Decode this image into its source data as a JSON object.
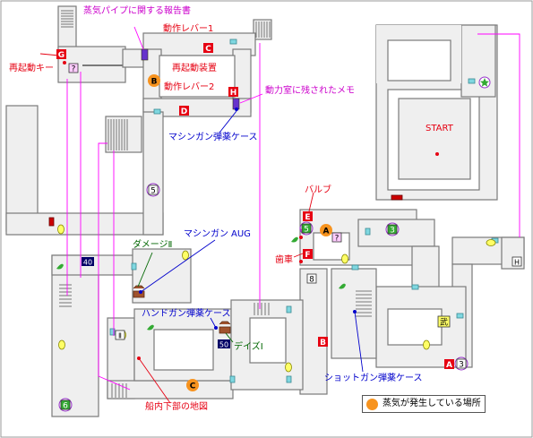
{
  "labels": {
    "steam_pipe_report": "蒸気パイプに関する報告書",
    "operate_lever_1": "動作レバー1",
    "restart_device": "再起動装置",
    "operate_lever_2": "動作レバー2",
    "power_room_memo": "動力室に残されたメモ",
    "restart_key": "再起動キー",
    "machinegun_ammo_case_1": "マシンガン弾薬ケース",
    "valve": "バルブ",
    "gear": "歯車",
    "damage_2": "ダメージⅡ",
    "machinegun": "マシンガン",
    "aug": "AUG",
    "handgun_ammo_case": "ハンドガン弾薬ケース",
    "days_1": "デイズⅠ",
    "shotgun_ammo_case": "ショットガン弾薬ケース",
    "lower_ship_map": "船内下部の地図",
    "start": "START"
  },
  "markers": {
    "G": "G",
    "C": "C",
    "B_orange": "B",
    "H": "H",
    "D": "D",
    "E": "E",
    "F": "F",
    "A_orange": "A",
    "B_red": "B",
    "A_red": "A",
    "C_orange": "C",
    "num5": "5",
    "num5b": "5",
    "num3": "3",
    "num3b": "3",
    "num6": "6",
    "num8": "8",
    "num40": "40",
    "num50": "50",
    "ii": "Ⅱ",
    "bu": "武",
    "q1": "?",
    "q2": "?",
    "ha": "H"
  },
  "legend": {
    "text": "蒸気が発生している場所"
  },
  "colors": {
    "floor": "#efefef",
    "wall": "#808080",
    "red_marker": "#e60012",
    "orange_marker": "#f7931e",
    "door": "#7fd7e0",
    "magenta_line": "#ff00ff",
    "blue_line": "#0000cc",
    "purple_item": "#6633cc",
    "green_leaf": "#33aa33",
    "yellow_item": "#ffff66"
  }
}
